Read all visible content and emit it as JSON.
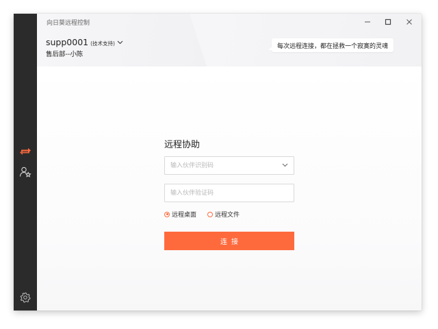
{
  "window": {
    "title": "向日葵远程控制"
  },
  "account": {
    "id": "supp0001",
    "role": "(技术支持)",
    "department": "售后部--小陈"
  },
  "banner": {
    "slogan": "每次远程连接，都在拯救一个寂寞的灵魂"
  },
  "sidebar": {
    "items": [
      {
        "icon": "remote-transfer-icon",
        "active": true
      },
      {
        "icon": "contacts-star-icon",
        "active": false
      }
    ],
    "settings_icon": "gear-icon"
  },
  "form": {
    "title": "远程协助",
    "partner_id_placeholder": "输入伙伴识别码",
    "verify_code_placeholder": "输入伙伴验证码",
    "modes": [
      {
        "label": "远程桌面",
        "selected": true
      },
      {
        "label": "远程文件",
        "selected": false
      }
    ],
    "connect_label": "连接"
  },
  "colors": {
    "accent": "#ff6a3d",
    "sidebar": "#2b2b2b"
  }
}
